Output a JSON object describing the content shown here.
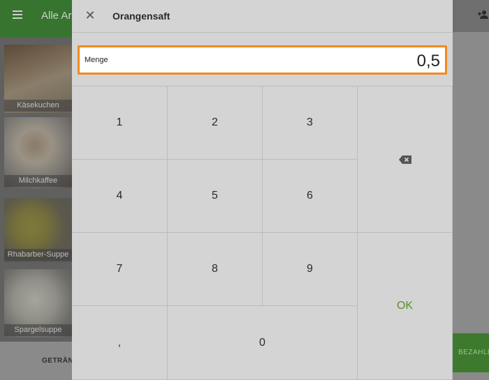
{
  "app": {
    "title": "Alle Artikel",
    "bottom_tab": "GETRÄNKE",
    "pay_label": "BEZAHLEN"
  },
  "sidebar": {
    "tiles": [
      {
        "label": "Käsekuchen"
      },
      {
        "label": "Milchkaffee"
      },
      {
        "label": "Rhabarber-Suppe"
      },
      {
        "label": "Spargelsuppe"
      }
    ]
  },
  "dialog": {
    "title": "Orangensaft",
    "quantity_label": "Menge",
    "quantity_value": "0,5"
  },
  "keypad": {
    "k1": "1",
    "k2": "2",
    "k3": "3",
    "k4": "4",
    "k5": "5",
    "k6": "6",
    "k7": "7",
    "k8": "8",
    "k9": "9",
    "comma": ",",
    "k0": "0",
    "ok": "OK"
  },
  "colors": {
    "accent_orange": "#f08a1e",
    "ok_green": "#5a8f2c",
    "app_green": "#37742f"
  },
  "icons": [
    "menu-icon",
    "add-user-icon",
    "close-icon",
    "backspace-icon"
  ]
}
